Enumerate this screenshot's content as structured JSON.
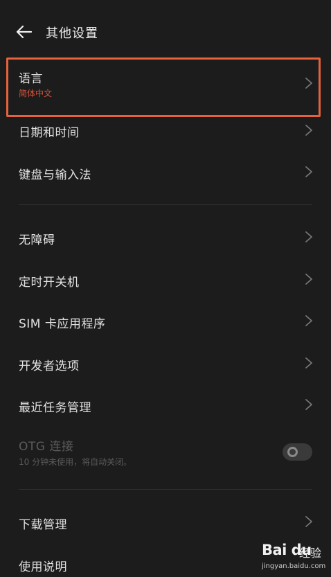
{
  "header": {
    "title": "其他设置",
    "back_icon": "back-arrow-icon"
  },
  "colors": {
    "background": "#1c1c1c",
    "accent": "#e5623d",
    "subtitle": "#d8553b",
    "disabled": "#5b5b5b"
  },
  "items": [
    {
      "label": "语言",
      "sub": "简体中文"
    },
    {
      "label": "日期和时间"
    },
    {
      "label": "键盘与输入法"
    },
    {
      "label": "无障碍"
    },
    {
      "label": "定时开关机"
    },
    {
      "label": "SIM 卡应用程序"
    },
    {
      "label": "开发者选项"
    },
    {
      "label": "最近任务管理"
    },
    {
      "label": "OTG 连接",
      "sub": "10 分钟未使用，将自动关闭。",
      "toggle": "off"
    },
    {
      "label": "下载管理"
    },
    {
      "label": "使用说明"
    }
  ],
  "watermark": {
    "brand": "Bai du",
    "text": "经验",
    "url": "jingyan.baidu.com"
  }
}
